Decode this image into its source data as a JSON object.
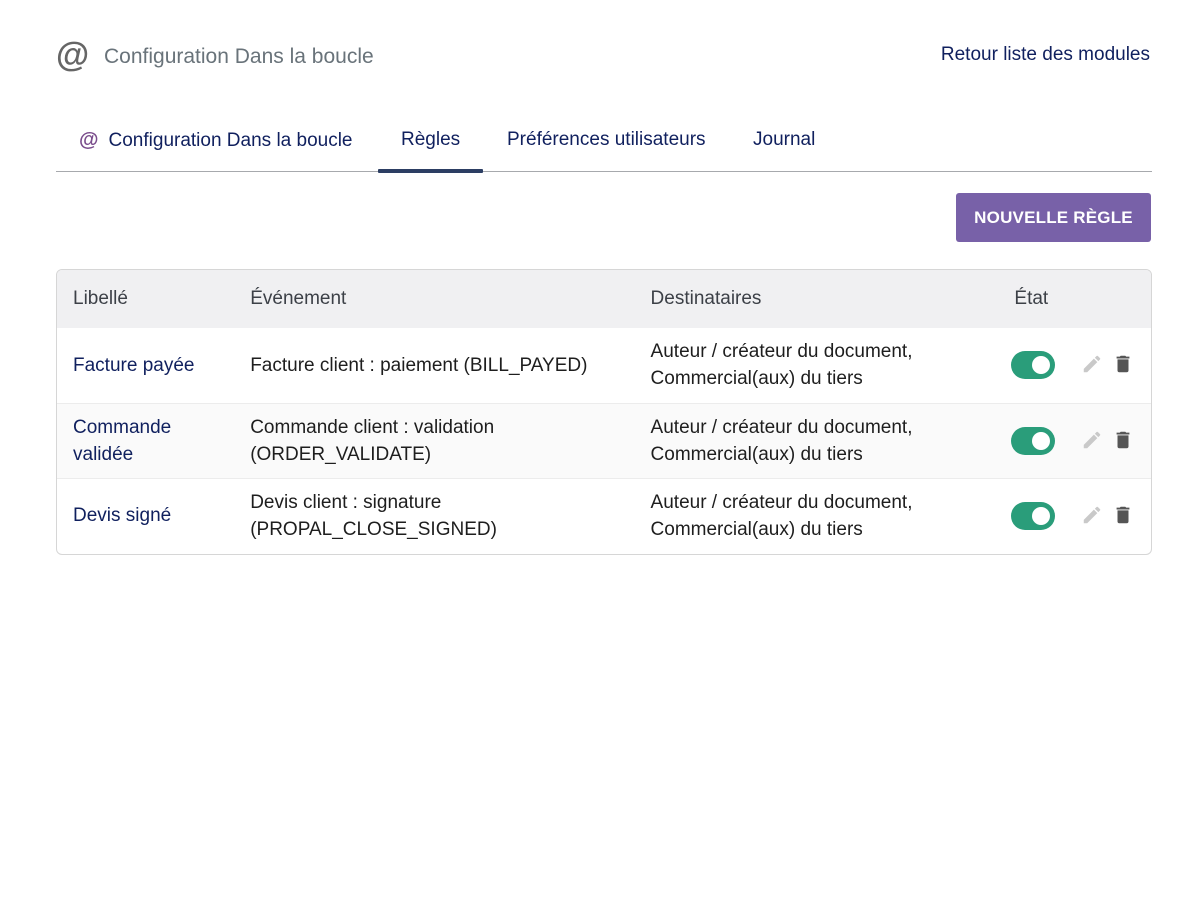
{
  "header": {
    "icon": "at-icon",
    "title": "Configuration Dans la boucle",
    "back_link": "Retour liste des modules"
  },
  "tabs": [
    {
      "label": "Configuration Dans la boucle",
      "icon": "at-icon",
      "active": false
    },
    {
      "label": "Règles",
      "active": true
    },
    {
      "label": "Préférences utilisateurs",
      "active": false
    },
    {
      "label": "Journal",
      "active": false
    }
  ],
  "actions": {
    "new_rule_label": "NOUVELLE RÈGLE"
  },
  "table": {
    "columns": [
      "Libellé",
      "Événement",
      "Destinataires",
      "État"
    ],
    "rows": [
      {
        "label": "Facture payée",
        "event_line1": "Facture client : paiement (BILL_PAYED)",
        "event_line2": "",
        "dest_line1": "Auteur / créateur du document,",
        "dest_line2": "Commercial(aux) du tiers",
        "enabled": true
      },
      {
        "label_line1": "Commande",
        "label_line2": "validée",
        "event_line1": "Commande client : validation",
        "event_line2": "(ORDER_VALIDATE)",
        "dest_line1": "Auteur / créateur du document,",
        "dest_line2": "Commercial(aux) du tiers",
        "enabled": true
      },
      {
        "label": "Devis signé",
        "event_line1": "Devis client : signature",
        "event_line2": "(PROPAL_CLOSE_SIGNED)",
        "dest_line1": "Auteur / créateur du document,",
        "dest_line2": "Commercial(aux) du tiers",
        "enabled": true
      }
    ]
  },
  "colors": {
    "accent_button": "#7861a8",
    "toggle_on": "#2a9d7a",
    "link": "#10205e",
    "tab_indicator": "#2c3e63"
  }
}
